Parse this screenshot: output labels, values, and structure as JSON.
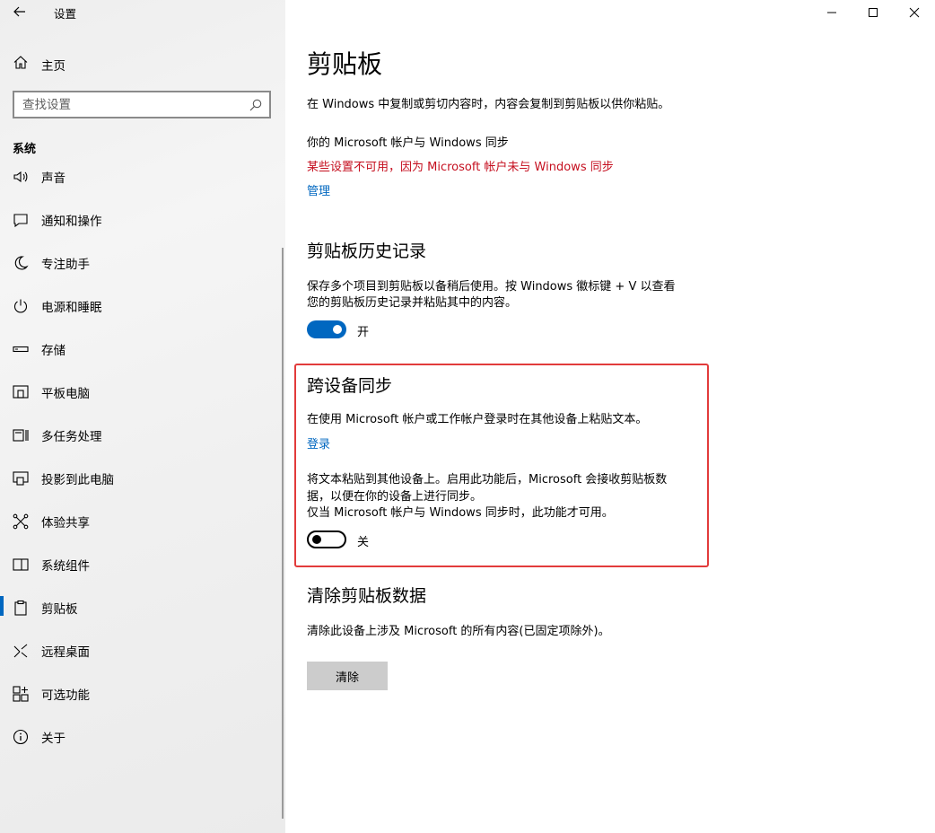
{
  "window": {
    "title": "设置",
    "controls": [
      "minimize",
      "maximize",
      "close"
    ]
  },
  "sidebar": {
    "home_label": "主页",
    "search_placeholder": "查找设置",
    "section_header": "系统",
    "items": [
      {
        "label": "声音",
        "icon": "speaker-icon",
        "selected": false
      },
      {
        "label": "通知和操作",
        "icon": "notification-icon",
        "selected": false
      },
      {
        "label": "专注助手",
        "icon": "moon-icon",
        "selected": false
      },
      {
        "label": "电源和睡眠",
        "icon": "power-icon",
        "selected": false
      },
      {
        "label": "存储",
        "icon": "storage-icon",
        "selected": false
      },
      {
        "label": "平板电脑",
        "icon": "tablet-icon",
        "selected": false
      },
      {
        "label": "多任务处理",
        "icon": "multitask-icon",
        "selected": false
      },
      {
        "label": "投影到此电脑",
        "icon": "project-icon",
        "selected": false
      },
      {
        "label": "体验共享",
        "icon": "share-icon",
        "selected": false
      },
      {
        "label": "系统组件",
        "icon": "component-icon",
        "selected": false
      },
      {
        "label": "剪贴板",
        "icon": "clipboard-icon",
        "selected": true
      },
      {
        "label": "远程桌面",
        "icon": "remote-icon",
        "selected": false
      },
      {
        "label": "可选功能",
        "icon": "optional-features-icon",
        "selected": false
      },
      {
        "label": "关于",
        "icon": "info-icon",
        "selected": false
      }
    ]
  },
  "main": {
    "title": "剪贴板",
    "intro": "在 Windows 中复制或剪切内容时，内容会复制到剪贴板以供你粘贴。",
    "sync_heading": "你的 Microsoft 帐户与 Windows 同步",
    "sync_warning": "某些设置不可用，因为 Microsoft 帐户未与 Windows 同步",
    "manage_link": "管理",
    "history": {
      "heading": "剪贴板历史记录",
      "desc_line1": "保存多个项目到剪贴板以备稍后使用。按 Windows 徽标键 + V 以查看",
      "desc_line2": "您的剪贴板历史记录并粘贴其中的内容。",
      "toggle_state": "开",
      "toggle_on": true
    },
    "cross_device": {
      "heading": "跨设备同步",
      "desc": "在使用 Microsoft 帐户或工作帐户登录时在其他设备上粘贴文本。",
      "signin_link": "登录",
      "info_line1": "将文本粘贴到其他设备上。启用此功能后，Microsoft 会接收剪贴板数",
      "info_line2": "据，以便在你的设备上进行同步。",
      "info_line3": "仅当 Microsoft 帐户与 Windows 同步时，此功能才可用。",
      "toggle_state": "关",
      "toggle_on": false
    },
    "clear": {
      "heading": "清除剪贴板数据",
      "desc": "清除此设备上涉及 Microsoft 的所有内容(已固定项除外)。",
      "button_label": "清除"
    }
  },
  "colors": {
    "accent": "#0067c0",
    "warning": "#c50f1f",
    "highlight_border": "#e23b3b"
  }
}
